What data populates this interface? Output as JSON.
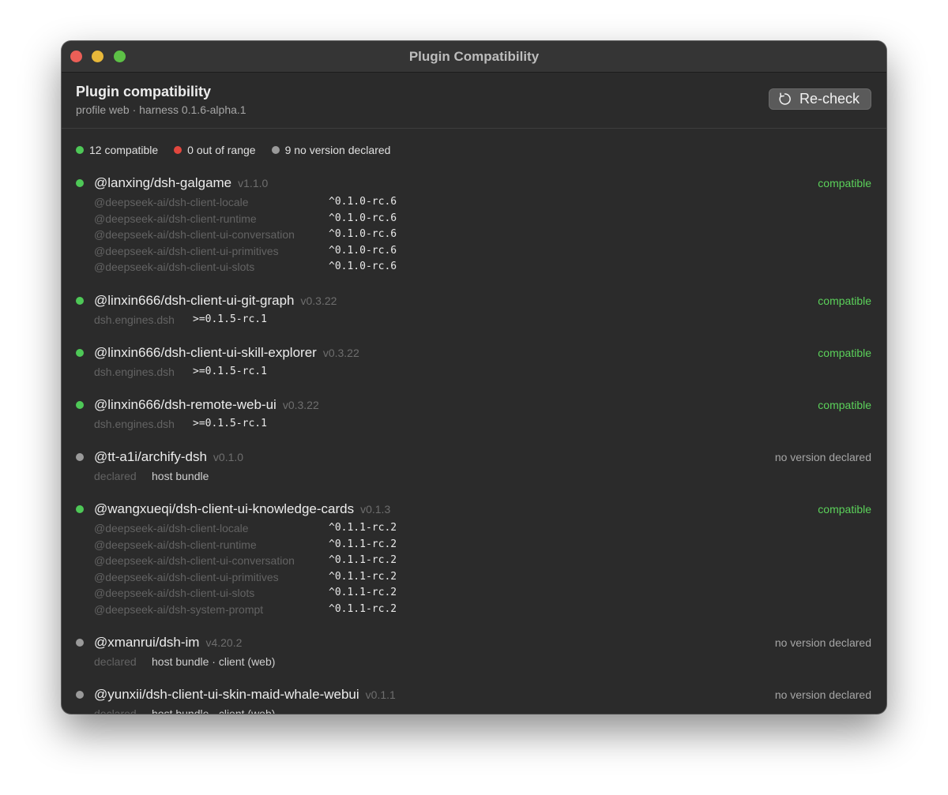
{
  "window": {
    "title": "Plugin Compatibility"
  },
  "header": {
    "title": "Plugin compatibility",
    "subtitle": "profile web · harness 0.1.6-alpha.1",
    "recheck_label": "Re-check"
  },
  "summary": {
    "compatible": "12 compatible",
    "out_of_range": "0 out of range",
    "no_version": "9 no version declared"
  },
  "colors": {
    "compatible": "#4ec857",
    "out_of_range": "#e2473e",
    "no_version": "#9a9a9a",
    "status_text": "#5bd15a"
  },
  "plugins": [
    {
      "name": "@lanxing/dsh-galgame",
      "version": "v1.1.0",
      "status": "compatible",
      "deps": [
        {
          "name": "@deepseek-ai/dsh-client-locale",
          "range": "^0.1.0-rc.6"
        },
        {
          "name": "@deepseek-ai/dsh-client-runtime",
          "range": "^0.1.0-rc.6"
        },
        {
          "name": "@deepseek-ai/dsh-client-ui-conversation",
          "range": "^0.1.0-rc.6"
        },
        {
          "name": "@deepseek-ai/dsh-client-ui-primitives",
          "range": "^0.1.0-rc.6"
        },
        {
          "name": "@deepseek-ai/dsh-client-ui-slots",
          "range": "^0.1.0-rc.6"
        }
      ]
    },
    {
      "name": "@linxin666/dsh-client-ui-git-graph",
      "version": "v0.3.22",
      "status": "compatible",
      "engine": {
        "label": "dsh.engines.dsh",
        "range": ">=0.1.5-rc.1"
      }
    },
    {
      "name": "@linxin666/dsh-client-ui-skill-explorer",
      "version": "v0.3.22",
      "status": "compatible",
      "engine": {
        "label": "dsh.engines.dsh",
        "range": ">=0.1.5-rc.1"
      }
    },
    {
      "name": "@linxin666/dsh-remote-web-ui",
      "version": "v0.3.22",
      "status": "compatible",
      "engine": {
        "label": "dsh.engines.dsh",
        "range": ">=0.1.5-rc.1"
      }
    },
    {
      "name": "@tt-a1i/archify-dsh",
      "version": "v0.1.0",
      "status": "no version declared",
      "declared": {
        "label": "declared",
        "value": "host bundle"
      }
    },
    {
      "name": "@wangxueqi/dsh-client-ui-knowledge-cards",
      "version": "v0.1.3",
      "status": "compatible",
      "deps": [
        {
          "name": "@deepseek-ai/dsh-client-locale",
          "range": "^0.1.1-rc.2"
        },
        {
          "name": "@deepseek-ai/dsh-client-runtime",
          "range": "^0.1.1-rc.2"
        },
        {
          "name": "@deepseek-ai/dsh-client-ui-conversation",
          "range": "^0.1.1-rc.2"
        },
        {
          "name": "@deepseek-ai/dsh-client-ui-primitives",
          "range": "^0.1.1-rc.2"
        },
        {
          "name": "@deepseek-ai/dsh-client-ui-slots",
          "range": "^0.1.1-rc.2"
        },
        {
          "name": "@deepseek-ai/dsh-system-prompt",
          "range": "^0.1.1-rc.2"
        }
      ]
    },
    {
      "name": "@xmanrui/dsh-im",
      "version": "v4.20.2",
      "status": "no version declared",
      "declared": {
        "label": "declared",
        "value": "host bundle · client (web)"
      }
    },
    {
      "name": "@yunxii/dsh-client-ui-skin-maid-whale-webui",
      "version": "v0.1.1",
      "status": "no version declared",
      "declared": {
        "label": "declared",
        "value": "host bundle · client (web)"
      }
    }
  ]
}
